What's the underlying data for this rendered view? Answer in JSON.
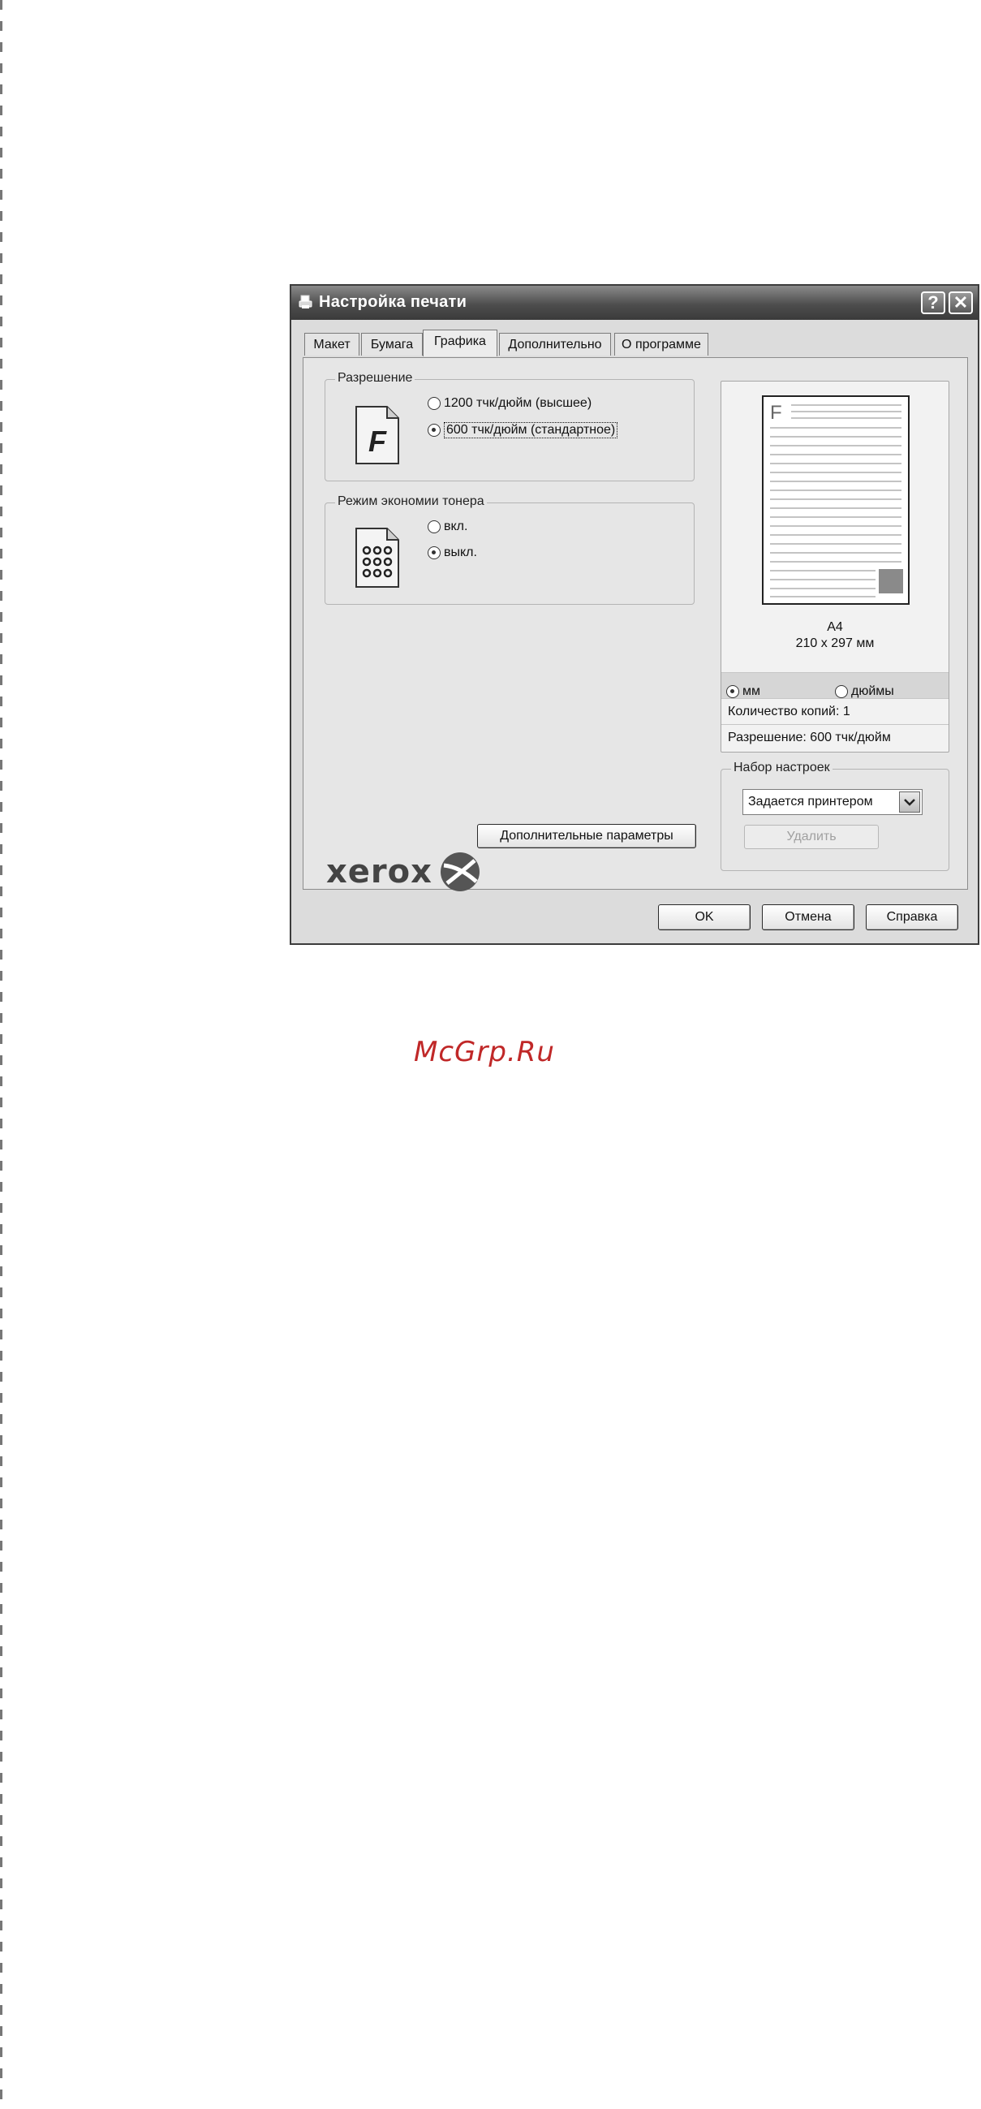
{
  "window": {
    "title": "Настройка печати",
    "help_button": "?",
    "close_button": "✕"
  },
  "tabs": [
    "Макет",
    "Бумага",
    "Графика",
    "Дополнительно",
    "О программе"
  ],
  "active_tab": "Графика",
  "resolution": {
    "group_label": "Разрешение",
    "options": [
      "1200 тчк/дюйм (высшее)",
      "600 тчк/дюйм (стандартное)"
    ],
    "selected": "600 тчк/дюйм (стандартное)"
  },
  "toner_save": {
    "group_label": "Режим экономии тонера",
    "options": [
      "вкл.",
      "выкл."
    ],
    "selected": "выкл."
  },
  "advanced_button": "Дополнительные параметры",
  "brand": "xerox",
  "preview": {
    "page_letter": "F",
    "paper_name": "A4",
    "paper_size": "210 x 297 мм",
    "units": [
      "мм",
      "дюймы"
    ],
    "selected_unit": "мм",
    "copies": "Количество копий: 1",
    "resolution": "Разрешение: 600 тчк/дюйм"
  },
  "presets": {
    "group_label": "Набор настроек",
    "selected": "Задается принтером",
    "delete_button": "Удалить"
  },
  "footer": {
    "ok": "OK",
    "cancel": "Отмена",
    "help": "Справка"
  },
  "watermark": "McGrp.Ru"
}
